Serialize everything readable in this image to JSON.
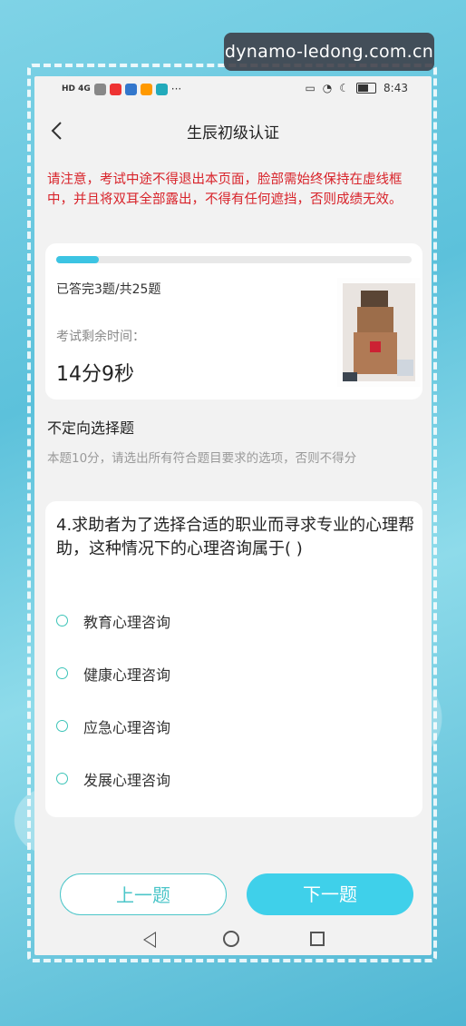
{
  "watermark": "dynamo-ledong.com.cn",
  "status_bar": {
    "network": "HD 4G",
    "time": "8:43"
  },
  "header": {
    "title": "生辰初级认证"
  },
  "warning_text": "请注意，考试中途不得退出本页面，脸部需始终保持在虚线框中，并且将双耳全部露出，不得有任何遮挡，否则成绩无效。",
  "progress": {
    "answered_text": "已答完3题/共25题",
    "answered": 3,
    "total": 25,
    "time_label": "考试剩余时间：",
    "time_value": "14分9秒"
  },
  "section": {
    "title": "不定向选择题",
    "description": "本题10分，请选出所有符合题目要求的选项，否则不得分"
  },
  "question": {
    "text": "4.求助者为了选择合适的职业而寻求专业的心理帮助，这种情况下的心理咨询属于(    )",
    "options": [
      {
        "label": "教育心理咨询"
      },
      {
        "label": "健康心理咨询"
      },
      {
        "label": "应急心理咨询"
      },
      {
        "label": "发展心理咨询"
      }
    ]
  },
  "buttons": {
    "prev": "上一题",
    "next": "下一题"
  },
  "colors": {
    "accent": "#3fd0ea",
    "warning": "#d8232a",
    "outline": "#4cc6c9"
  }
}
